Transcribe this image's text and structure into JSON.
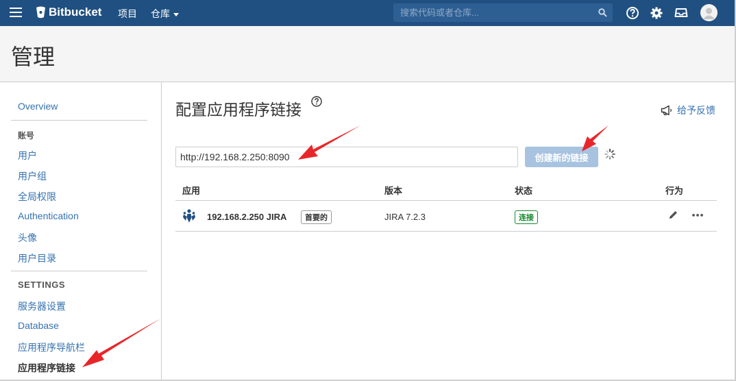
{
  "topnav": {
    "brand": "Bitbucket",
    "projects": "项目",
    "repos": "仓库",
    "search_placeholder": "搜索代码或者仓库..."
  },
  "header": {
    "title": "管理"
  },
  "sidebar": {
    "overview": "Overview",
    "accounts_heading": "账号",
    "users": "用户",
    "groups": "用户组",
    "global_permissions": "全局权限",
    "authentication": "Authentication",
    "avatars": "头像",
    "user_directories": "用户目录",
    "settings_heading": "SETTINGS",
    "server_settings": "服务器设置",
    "database": "Database",
    "app_navigator": "应用程序导航栏",
    "app_links": "应用程序链接"
  },
  "main": {
    "title": "配置应用程序链接",
    "feedback": "给予反馈",
    "url_value": "http://192.168.2.250:8090",
    "create_button": "创建新的链接",
    "table": {
      "headers": {
        "app": "应用",
        "version": "版本",
        "status": "状态",
        "actions": "行为"
      },
      "rows": [
        {
          "name": "192.168.2.250 JIRA",
          "primary": "首要的",
          "version": "JIRA 7.2.3",
          "status": "连接"
        }
      ]
    }
  },
  "colors": {
    "nav": "#205081",
    "link": "#3572b0",
    "status_ok": "#14892c",
    "annotation_arrow": "#e8262a"
  }
}
